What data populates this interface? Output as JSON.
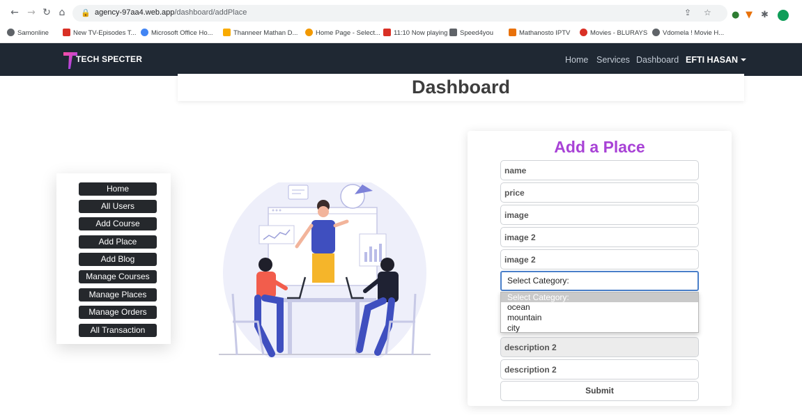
{
  "browser": {
    "url_host": "agency-97aa4.web.app",
    "url_path": "/dashboard/addPlace",
    "bookmarks": [
      {
        "label": "Samonline",
        "color": "#5f6368"
      },
      {
        "label": "New TV-Episodes T...",
        "color": "#d93025"
      },
      {
        "label": "Microsoft Office Ho...",
        "color": "#4285f4"
      },
      {
        "label": "Thanneer Mathan D...",
        "color": "#f9ab00"
      },
      {
        "label": "Home Page - Select...",
        "color": "#f29900"
      },
      {
        "label": "11:10 Now playing",
        "color": "#d93025"
      },
      {
        "label": "Speed4you",
        "color": "#5f6368"
      },
      {
        "label": "Mathanosto IPTV",
        "color": "#e8710a"
      },
      {
        "label": "Movies - BLURAYS",
        "color": "#d93025"
      },
      {
        "label": "Vdomela ! Movie H...",
        "color": "#5f6368"
      }
    ]
  },
  "navbar": {
    "brand": "TECH SPECTER",
    "links": [
      "Home",
      "Services",
      "Dashboard"
    ],
    "user": "EFTI HASAN"
  },
  "page": {
    "title": "Dashboard"
  },
  "sidebar": {
    "items": [
      "Home",
      "All Users",
      "Add Course",
      "Add Place",
      "Add Blog",
      "Manage Courses",
      "Manage Places",
      "Manage Orders",
      "All Transaction"
    ]
  },
  "form": {
    "title": "Add a Place",
    "fields": [
      "name",
      "price",
      "image",
      "image 2",
      "image 2"
    ],
    "select_value": "Select Category:",
    "options": [
      "Select Category:",
      "ocean",
      "mountain",
      "city"
    ],
    "lower_fields": [
      "description 2",
      "description 2"
    ],
    "submit_label": "Submit"
  },
  "colors": {
    "navbar_bg": "#1f2833",
    "accent": "#a842d6",
    "sidebar_button": "#25282c"
  }
}
